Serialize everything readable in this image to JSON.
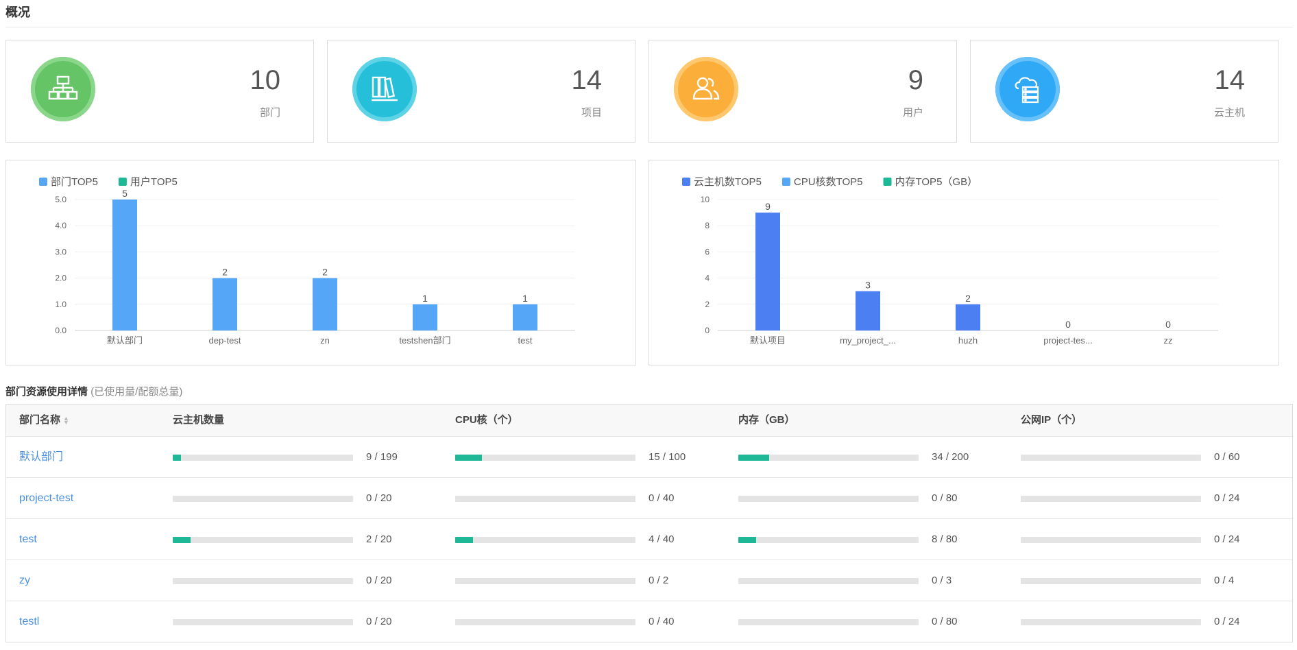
{
  "header": {
    "title": "概况"
  },
  "stats": [
    {
      "value": "10",
      "label": "部门",
      "icon": "department-icon",
      "color": "#65c466",
      "ring": "#8ad68b"
    },
    {
      "value": "14",
      "label": "项目",
      "icon": "project-icon",
      "color": "#26bfd9",
      "ring": "#5fd3e6"
    },
    {
      "value": "9",
      "label": "用户",
      "icon": "user-icon",
      "color": "#fbae3a",
      "ring": "#ffc86e"
    },
    {
      "value": "14",
      "label": "云主机",
      "icon": "cloud-server-icon",
      "color": "#2fa8f5",
      "ring": "#66c0fa"
    }
  ],
  "chart_data": [
    {
      "type": "bar",
      "legend": [
        {
          "name": "部门TOP5",
          "color": "#55a6f7"
        },
        {
          "name": "用户TOP5",
          "color": "#1fb897"
        }
      ],
      "categories": [
        "默认部门",
        "dep-test",
        "zn",
        "testshen部门",
        "test"
      ],
      "series": [
        {
          "name": "部门TOP5",
          "values": [
            5,
            2,
            2,
            1,
            1
          ],
          "color": "#55a6f7"
        }
      ],
      "ylim": [
        0,
        5
      ],
      "yticks": [
        "0.0",
        "1.0",
        "2.0",
        "3.0",
        "4.0",
        "5.0"
      ],
      "legend_position": "top-left",
      "grid": true
    },
    {
      "type": "bar",
      "legend": [
        {
          "name": "云主机数TOP5",
          "color": "#4b7ff2"
        },
        {
          "name": "CPU核数TOP5",
          "color": "#55a6f7"
        },
        {
          "name": "内存TOP5（GB）",
          "color": "#1fb897"
        }
      ],
      "categories": [
        "默认项目",
        "my_project_...",
        "huzh",
        "project-tes...",
        "zz"
      ],
      "series": [
        {
          "name": "云主机数TOP5",
          "values": [
            9,
            3,
            2,
            0,
            0
          ],
          "color": "#4b7ff2"
        }
      ],
      "ylim": [
        0,
        10
      ],
      "yticks": [
        "0",
        "2",
        "4",
        "6",
        "8",
        "10"
      ],
      "legend_position": "top-left",
      "grid": true
    }
  ],
  "section": {
    "title": "部门资源使用详情",
    "subtitle": "(已使用量/配额总量)"
  },
  "table": {
    "columns": [
      "部门名称",
      "云主机数量",
      "CPU核（个）",
      "内存（GB）",
      "公网IP（个）"
    ],
    "rows": [
      {
        "name": "默认部门",
        "cells": [
          {
            "used": 9,
            "total": 199,
            "text": "9 / 199"
          },
          {
            "used": 15,
            "total": 100,
            "text": "15 / 100"
          },
          {
            "used": 34,
            "total": 200,
            "text": "34 / 200"
          },
          {
            "used": 0,
            "total": 60,
            "text": "0 / 60"
          }
        ]
      },
      {
        "name": "project-test",
        "cells": [
          {
            "used": 0,
            "total": 20,
            "text": "0 / 20"
          },
          {
            "used": 0,
            "total": 40,
            "text": "0 / 40"
          },
          {
            "used": 0,
            "total": 80,
            "text": "0 / 80"
          },
          {
            "used": 0,
            "total": 24,
            "text": "0 / 24"
          }
        ]
      },
      {
        "name": "test",
        "cells": [
          {
            "used": 2,
            "total": 20,
            "text": "2 / 20"
          },
          {
            "used": 4,
            "total": 40,
            "text": "4 / 40"
          },
          {
            "used": 8,
            "total": 80,
            "text": "8 / 80"
          },
          {
            "used": 0,
            "total": 24,
            "text": "0 / 24"
          }
        ]
      },
      {
        "name": "zy",
        "cells": [
          {
            "used": 0,
            "total": 20,
            "text": "0 / 20"
          },
          {
            "used": 0,
            "total": 2,
            "text": "0 / 2"
          },
          {
            "used": 0,
            "total": 3,
            "text": "0 / 3"
          },
          {
            "used": 0,
            "total": 4,
            "text": "0 / 4"
          }
        ]
      },
      {
        "name": "testl",
        "cells": [
          {
            "used": 0,
            "total": 20,
            "text": "0 / 20"
          },
          {
            "used": 0,
            "total": 40,
            "text": "0 / 40"
          },
          {
            "used": 0,
            "total": 80,
            "text": "0 / 80"
          },
          {
            "used": 0,
            "total": 24,
            "text": "0 / 24"
          }
        ]
      }
    ]
  }
}
